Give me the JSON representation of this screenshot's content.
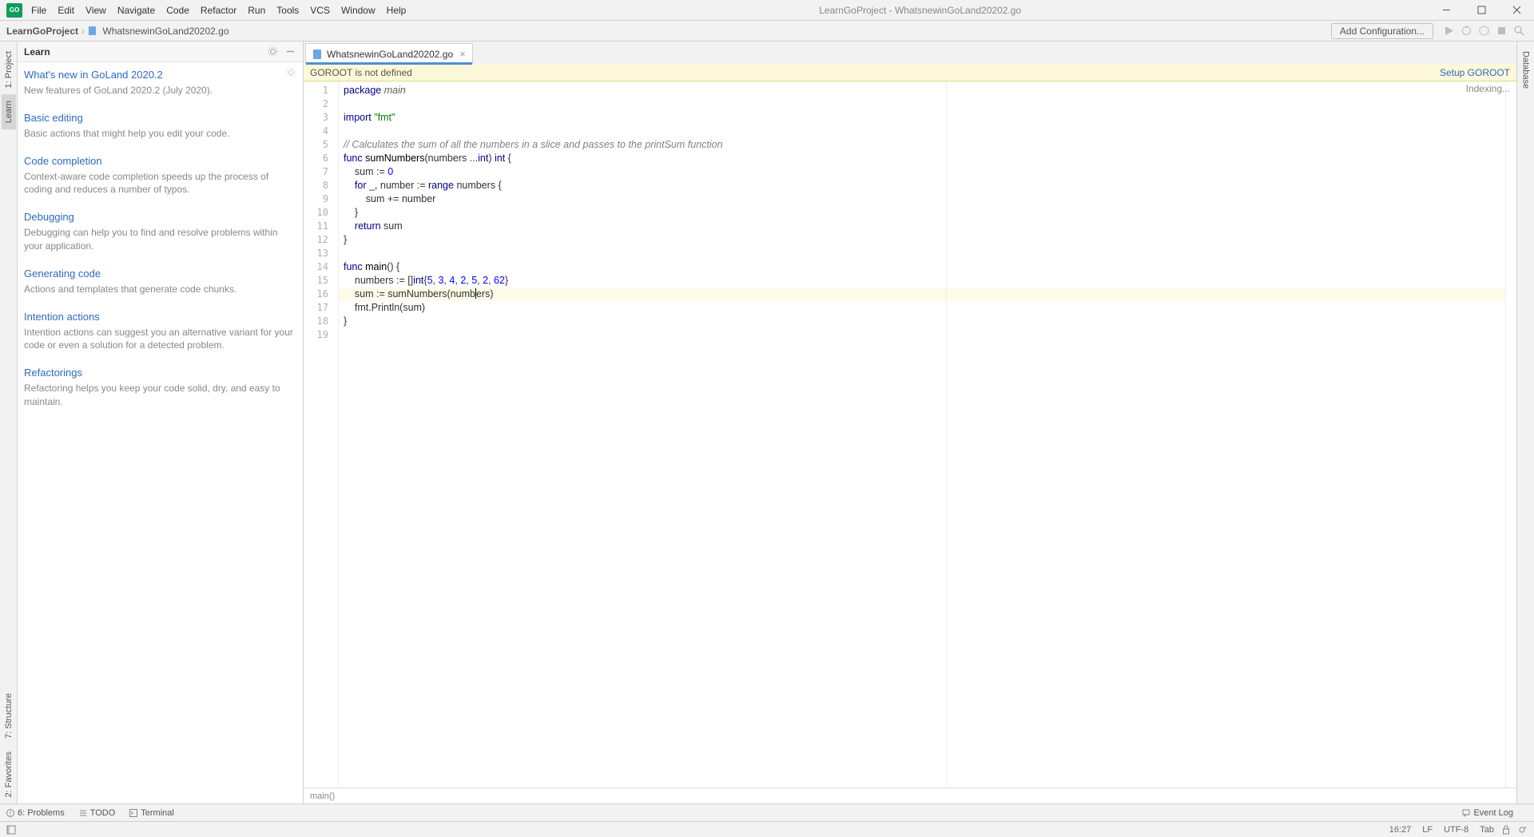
{
  "app_icon_text": "GO",
  "menus": [
    "File",
    "Edit",
    "View",
    "Navigate",
    "Code",
    "Refactor",
    "Run",
    "Tools",
    "VCS",
    "Window",
    "Help"
  ],
  "window_title": "LearnGoProject - WhatsnewinGoLand20202.go",
  "breadcrumbs": {
    "project": "LearnGoProject",
    "file": "WhatsnewinGoLand20202.go"
  },
  "add_config": "Add Configuration...",
  "left_tools": [
    {
      "label": "1: Project"
    },
    {
      "label": "Learn"
    },
    {
      "label": "7: Structure"
    },
    {
      "label": "2: Favorites"
    }
  ],
  "right_tools": [
    {
      "label": "Database"
    }
  ],
  "learn": {
    "title": "Learn",
    "items": [
      {
        "t": "What's new in GoLand 2020.2",
        "d": "New features of GoLand 2020.2 (July 2020)."
      },
      {
        "t": "Basic editing",
        "d": "Basic actions that might help you edit your code."
      },
      {
        "t": "Code completion",
        "d": "Context-aware code completion speeds up the process of coding and reduces a number of typos."
      },
      {
        "t": "Debugging",
        "d": "Debugging can help you to find and resolve problems within your application."
      },
      {
        "t": "Generating code",
        "d": "Actions and templates that generate code chunks."
      },
      {
        "t": "Intention actions",
        "d": "Intention actions can suggest you an alternative variant for your code or even a solution for a detected problem."
      },
      {
        "t": "Refactorings",
        "d": "Refactoring helps you keep your code solid, dry, and easy to maintain."
      }
    ]
  },
  "tab": {
    "label": "WhatsnewinGoLand20202.go"
  },
  "banner": {
    "msg": "GOROOT is not defined",
    "link": "Setup GOROOT"
  },
  "indexing": "Indexing...",
  "breadcrumb_fn": "main()",
  "code": {
    "lines": [
      1,
      2,
      3,
      4,
      5,
      6,
      7,
      8,
      9,
      10,
      11,
      12,
      13,
      14,
      15,
      16,
      17,
      18,
      19
    ]
  },
  "bottom": {
    "problems": "6: Problems",
    "todo": "TODO",
    "terminal": "Terminal",
    "eventlog": "Event Log"
  },
  "status": {
    "pos": "16:27",
    "sep": "LF",
    "enc": "UTF-8",
    "indent": "Tab"
  }
}
